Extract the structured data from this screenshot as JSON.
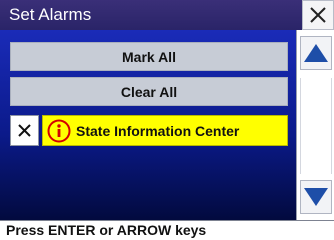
{
  "window": {
    "title": "Set Alarms",
    "close_icon": "close-x-icon"
  },
  "list": {
    "mark_all_label": "Mark All",
    "clear_all_label": "Clear All",
    "items": [
      {
        "label": "State Information Center",
        "checked": true,
        "check_icon": "x-mark-icon",
        "category_icon": "information-icon",
        "highlight_color": "#ffff00"
      }
    ]
  },
  "scrollbar": {
    "up_icon": "triangle-up-icon",
    "down_icon": "triangle-down-icon",
    "arrow_color": "#1e4ea8"
  },
  "status": {
    "message": "Press ENTER or ARROW keys"
  },
  "colors": {
    "titlebar": "#2a2468",
    "list_background": "#0b1a8a",
    "selected_row": "#ffff00",
    "info_icon": "#d40000"
  }
}
